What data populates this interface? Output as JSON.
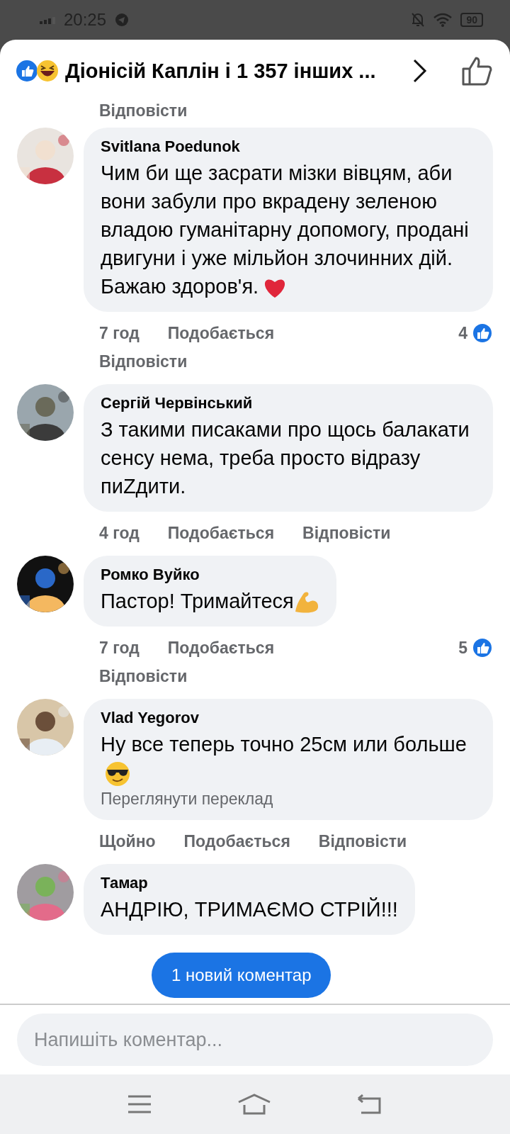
{
  "status_bar": {
    "time": "20:25",
    "battery": "90"
  },
  "header": {
    "title": "Діонісій Каплін і 1 357 інших ..."
  },
  "top_cut_reply": "Відповісти",
  "comments": [
    {
      "author": "Svitlana Poedunok",
      "text": "Чим би ще засрати мізки вівцям, аби вони забули про вкрадену зеленою владою гуманітарну допомогу, продані двигуни і уже мільйон злочинних дій.\nБажаю здоров'я.",
      "kind": "heart",
      "time": "7 год",
      "like": "Подобається",
      "reply": "Відповісти",
      "reactions": "4"
    },
    {
      "author": "Сергій Червінський",
      "kind": "plain",
      "text": "З такими писаками про щось балакати сенсу нема, треба просто відразу пиZдити.",
      "time": "4 год",
      "like": "Подобається",
      "reply": "Відповісти"
    },
    {
      "author": "Ромко Вуйко",
      "text": "Пастор! Тримайтеся",
      "kind": "muscle",
      "time": "7 год",
      "like": "Подобається",
      "reply": "Відповісти",
      "reactions": "5"
    },
    {
      "author": "Vlad  Yegorov",
      "text": "Ну все теперь точно 25см или больше",
      "kind": "sunglasses",
      "translate": "Переглянути переклад",
      "time": "Щойно",
      "like": "Подобається",
      "reply": "Відповісти"
    },
    {
      "author": "Тамар",
      "kind": "plain",
      "text": "АНДРІЮ, ТРИМАЄМО СТРІЙ!!!"
    }
  ],
  "new_comments_pill": "1 новий коментар",
  "composer": {
    "placeholder": "Напишіть коментар..."
  }
}
